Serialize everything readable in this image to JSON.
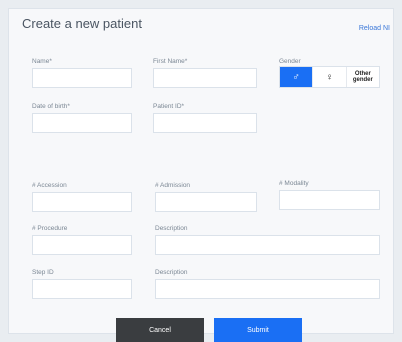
{
  "form": {
    "title": "Create a new patient",
    "reset_link": "Reload NI",
    "fields": {
      "name": {
        "label": "Name*",
        "value": ""
      },
      "first_name": {
        "label": "First Name*",
        "value": ""
      },
      "gender": {
        "label": "Gender",
        "options": [
          "male",
          "female",
          "Other gender"
        ],
        "selected": "male"
      },
      "date_of_birth": {
        "label": "Date of birth*",
        "value": ""
      },
      "patient_id": {
        "label": "Patient ID*",
        "value": ""
      },
      "accession": {
        "label": "# Accession",
        "value": ""
      },
      "admission": {
        "label": "# Admission",
        "value": ""
      },
      "modality": {
        "label": "# Modality",
        "value": ""
      },
      "procedure": {
        "label": "# Procedure",
        "value": ""
      },
      "procedure_description": {
        "label": "Description",
        "value": ""
      },
      "step_id": {
        "label": "Step ID",
        "value": ""
      },
      "step_description": {
        "label": "Description",
        "value": ""
      }
    },
    "gender_other_line1": "Other",
    "gender_other_line2": "gender",
    "buttons": {
      "cancel": "Cancel",
      "submit": "Submit"
    }
  },
  "colors": {
    "accent": "#1a6ff4",
    "cancel": "#3a3d40",
    "link": "#3a77d8"
  },
  "icons": {
    "male": "male-symbol-icon",
    "female": "female-symbol-icon"
  }
}
